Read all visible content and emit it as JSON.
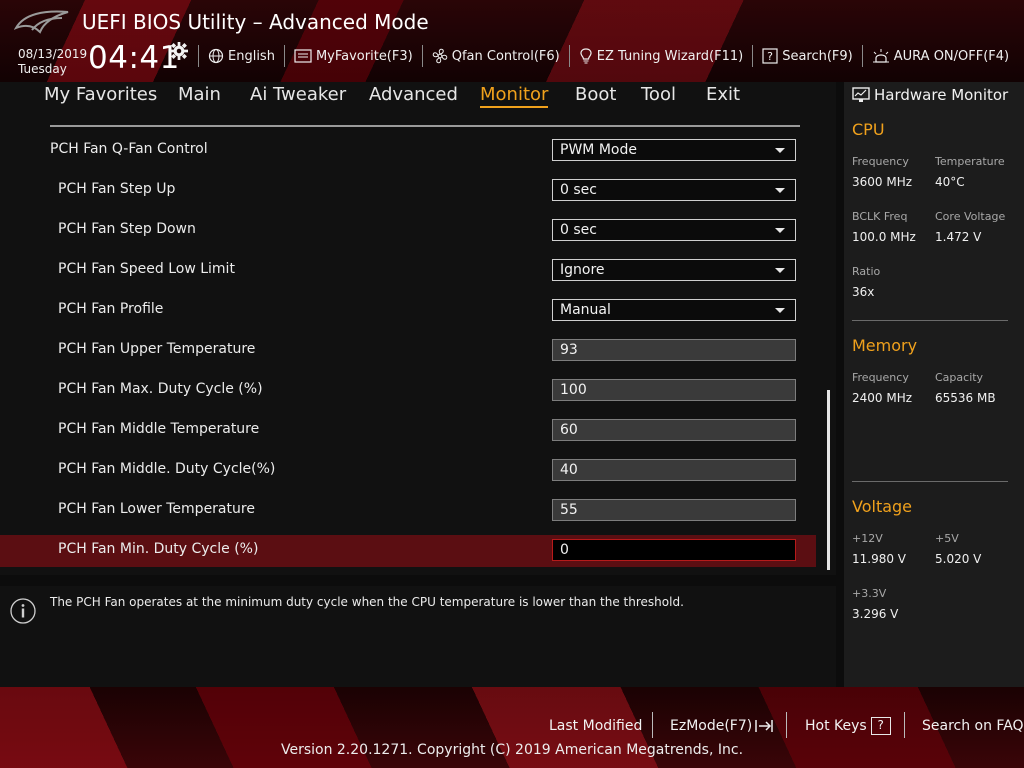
{
  "header": {
    "title": "UEFI BIOS Utility – Advanced Mode",
    "date": "08/13/2019",
    "day": "Tuesday",
    "time": "04:41",
    "tools": [
      {
        "label": "English",
        "icon": "globe-icon"
      },
      {
        "label": "MyFavorite(F3)",
        "icon": "favorite-icon"
      },
      {
        "label": "Qfan Control(F6)",
        "icon": "fan-icon"
      },
      {
        "label": "EZ Tuning Wizard(F11)",
        "icon": "bulb-icon"
      },
      {
        "label": "Search(F9)",
        "icon": "search-help-icon"
      },
      {
        "label": "AURA ON/OFF(F4)",
        "icon": "aura-icon"
      }
    ]
  },
  "nav": {
    "tabs": [
      "My Favorites",
      "Main",
      "Ai Tweaker",
      "Advanced",
      "Monitor",
      "Boot",
      "Tool",
      "Exit"
    ],
    "active": "Monitor"
  },
  "settings": [
    {
      "label": "PCH Fan Q-Fan Control",
      "type": "dropdown",
      "value": "PWM Mode"
    },
    {
      "label": "PCH Fan Step Up",
      "type": "dropdown",
      "value": "0 sec"
    },
    {
      "label": "PCH Fan Step Down",
      "type": "dropdown",
      "value": "0 sec"
    },
    {
      "label": "PCH Fan Speed Low Limit",
      "type": "dropdown",
      "value": "Ignore"
    },
    {
      "label": "PCH Fan Profile",
      "type": "dropdown",
      "value": "Manual"
    },
    {
      "label": "PCH Fan Upper Temperature",
      "type": "field",
      "value": "93"
    },
    {
      "label": "PCH Fan Max. Duty Cycle (%)",
      "type": "field",
      "value": "100"
    },
    {
      "label": "PCH Fan Middle Temperature",
      "type": "field",
      "value": "60"
    },
    {
      "label": "PCH Fan Middle. Duty Cycle(%)",
      "type": "field",
      "value": "40"
    },
    {
      "label": "PCH Fan Lower Temperature",
      "type": "field",
      "value": "55"
    },
    {
      "label": "PCH Fan Min. Duty Cycle (%)",
      "type": "field",
      "value": "0"
    }
  ],
  "help_text": "The PCH Fan operates at the minimum duty cycle when the CPU temperature is lower than the threshold.",
  "hardware_monitor": {
    "title": "Hardware Monitor",
    "cpu": {
      "heading": "CPU",
      "frequency_label": "Frequency",
      "frequency": "3600 MHz",
      "temperature_label": "Temperature",
      "temperature": "40°C",
      "bclk_label": "BCLK Freq",
      "bclk": "100.0 MHz",
      "core_voltage_label": "Core Voltage",
      "core_voltage": "1.472 V",
      "ratio_label": "Ratio",
      "ratio": "36x"
    },
    "memory": {
      "heading": "Memory",
      "frequency_label": "Frequency",
      "frequency": "2400 MHz",
      "capacity_label": "Capacity",
      "capacity": "65536 MB"
    },
    "voltage": {
      "heading": "Voltage",
      "v12_label": "+12V",
      "v12": "11.980 V",
      "v5_label": "+5V",
      "v5": "5.020 V",
      "v33_label": "+3.3V",
      "v33": "3.296 V"
    }
  },
  "footer": {
    "last_modified": "Last Modified",
    "ezmode": "EzMode(F7)",
    "hot_keys": "Hot Keys",
    "hot_keys_key": "?",
    "search_faq": "Search on FAQ",
    "copyright": "Version 2.20.1271. Copyright (C) 2019 American Megatrends, Inc."
  },
  "colors": {
    "accent": "#f0a11c",
    "highlight_row": "#5b0e12",
    "brand_red": "#b61a1a"
  }
}
